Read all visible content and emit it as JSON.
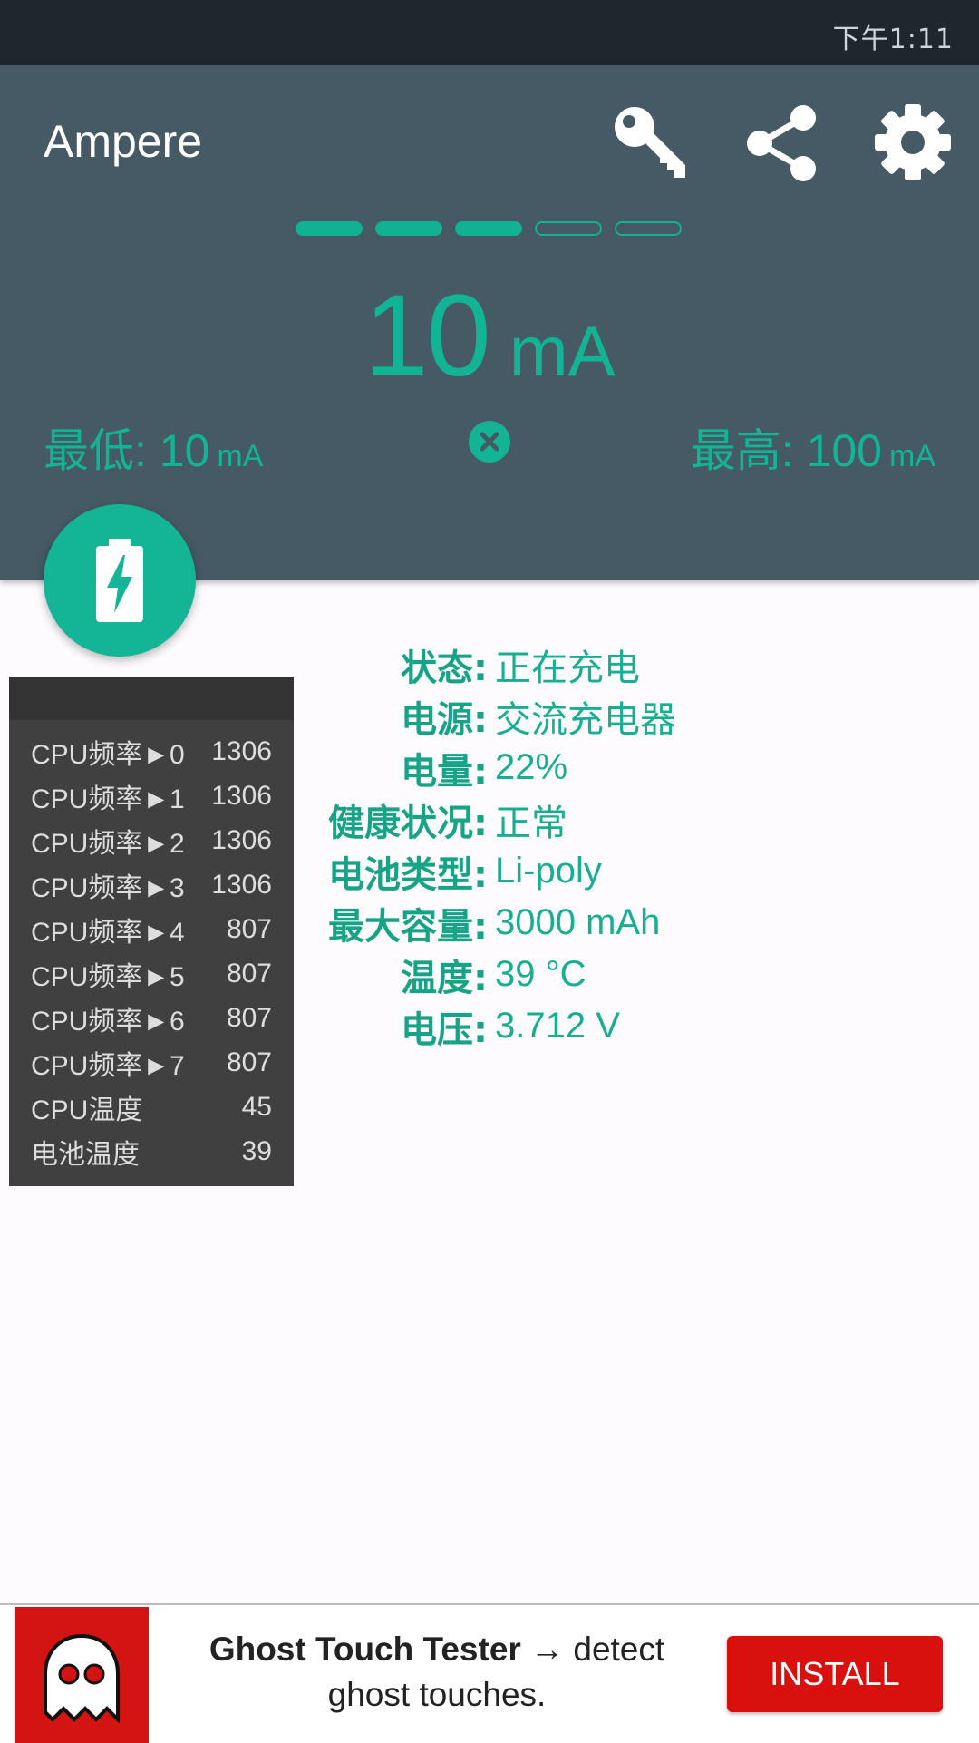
{
  "status_bar": {
    "time": "下午1:11"
  },
  "app": {
    "title": "Ampere",
    "colors": {
      "appbar": "#455a64",
      "accent": "#12b495"
    },
    "icons": [
      "key-icon",
      "share-icon",
      "settings-icon"
    ]
  },
  "meter": {
    "level_filled": 3,
    "level_total": 5,
    "current_value": "10",
    "current_unit": "mA",
    "min_label": "最低: 10",
    "min_unit": "mA",
    "max_label": "最高: 100",
    "max_unit": "mA"
  },
  "cpu_panel": {
    "rows": [
      {
        "label": "CPU频率►0",
        "value": "1306"
      },
      {
        "label": "CPU频率►1",
        "value": "1306"
      },
      {
        "label": "CPU频率►2",
        "value": "1306"
      },
      {
        "label": "CPU频率►3",
        "value": "1306"
      },
      {
        "label": "CPU频率►4",
        "value": "807"
      },
      {
        "label": "CPU频率►5",
        "value": "807"
      },
      {
        "label": "CPU频率►6",
        "value": "807"
      },
      {
        "label": "CPU频率►7",
        "value": "807"
      },
      {
        "label": "CPU温度",
        "value": "45"
      },
      {
        "label": "电池温度",
        "value": "39"
      }
    ]
  },
  "battery_info": [
    {
      "label": "状态:",
      "value": "正在充电"
    },
    {
      "label": "电源:",
      "value": "交流充电器"
    },
    {
      "label": "电量:",
      "value": "22%"
    },
    {
      "label": "健康状况:",
      "value": "正常"
    },
    {
      "label": "电池类型:",
      "value": "Li-poly"
    },
    {
      "label": "最大容量:",
      "value": "3000 mAh"
    },
    {
      "label": "温度:",
      "value": "39 °C"
    },
    {
      "label": "电压:",
      "value": "3.712 V"
    }
  ],
  "ad": {
    "title_bold": "Ghost Touch Tester",
    "title_rest": " → detect",
    "line2": "ghost touches.",
    "install_label": "INSTALL"
  }
}
